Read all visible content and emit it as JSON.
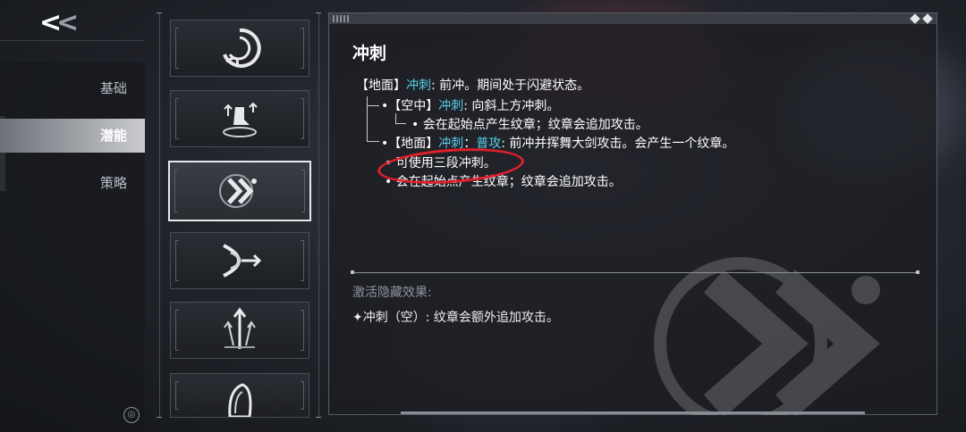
{
  "nav": {
    "back_label": "<<",
    "items": [
      {
        "label": "基础",
        "active": false
      },
      {
        "label": "潜能",
        "active": true
      },
      {
        "label": "策略",
        "active": false
      }
    ]
  },
  "skills": [
    {
      "icon": "swirl-wave-icon",
      "active": false
    },
    {
      "icon": "boot-jump-icon",
      "active": false
    },
    {
      "icon": "dash-chevron-icon",
      "active": true
    },
    {
      "icon": "arc-arrow-icon",
      "active": false
    },
    {
      "icon": "triple-arrow-icon",
      "active": false
    },
    {
      "icon": "beast-head-icon",
      "active": false
    }
  ],
  "detail": {
    "title": "冲刺",
    "l1_a": "【地面】",
    "l1_b": "冲刺",
    "l1_c": ": 前冲。期间处于闪避状态。",
    "l2_a": "•【空中】",
    "l2_b": "冲刺",
    "l2_c": ": 向斜上方冲刺。",
    "l3": "• 会在起始点产生纹章；纹章会追加攻击。",
    "l4_a": "•【地面】",
    "l4_b": "冲刺",
    "l4_c": "：",
    "l4_d": "普攻",
    "l4_e": ": 前冲并挥舞大剑攻击。会产生一个纹章。",
    "l5": "• 可使用三段冲刺。",
    "l6": "• 会在起始点产生纹章；纹章会追加攻击。",
    "hidden_label": "激活隐藏效果:",
    "hidden_effect": "✦冲刺（空）: 纹章会额外追加攻击。"
  },
  "colors": {
    "keyword": "#57d0e8",
    "annotation": "#e0202a"
  }
}
